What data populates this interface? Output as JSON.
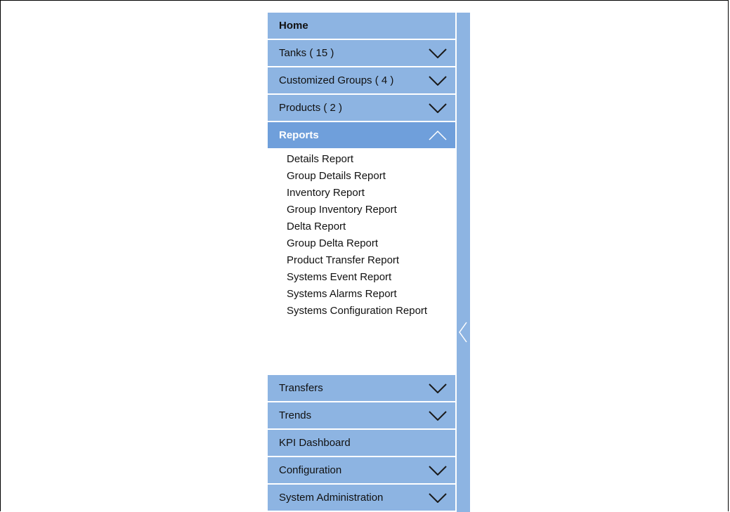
{
  "nav": {
    "home": "Home",
    "tanks": "Tanks ( 15 )",
    "customized_groups": "Customized Groups ( 4 )",
    "products": "Products ( 2 )",
    "reports": "Reports",
    "transfers": "Transfers",
    "trends": "Trends",
    "kpi_dashboard": "KPI Dashboard",
    "configuration": "Configuration",
    "system_administration": "System Administration"
  },
  "reports": {
    "items": [
      "Details Report",
      "Group Details Report",
      "Inventory Report",
      "Group Inventory Report",
      "Delta Report",
      "Group Delta Report",
      "Product Transfer Report",
      "Systems Event Report",
      "Systems Alarms Report",
      "Systems Configuration Report"
    ]
  },
  "icons": {
    "expand": "chevron-down-icon",
    "collapse": "chevron-up-icon",
    "panel_collapse": "chevron-left-icon"
  },
  "colors": {
    "nav_bg": "#8db4e2",
    "nav_active_bg": "#6f9fdb",
    "active_text": "#ffffff"
  }
}
